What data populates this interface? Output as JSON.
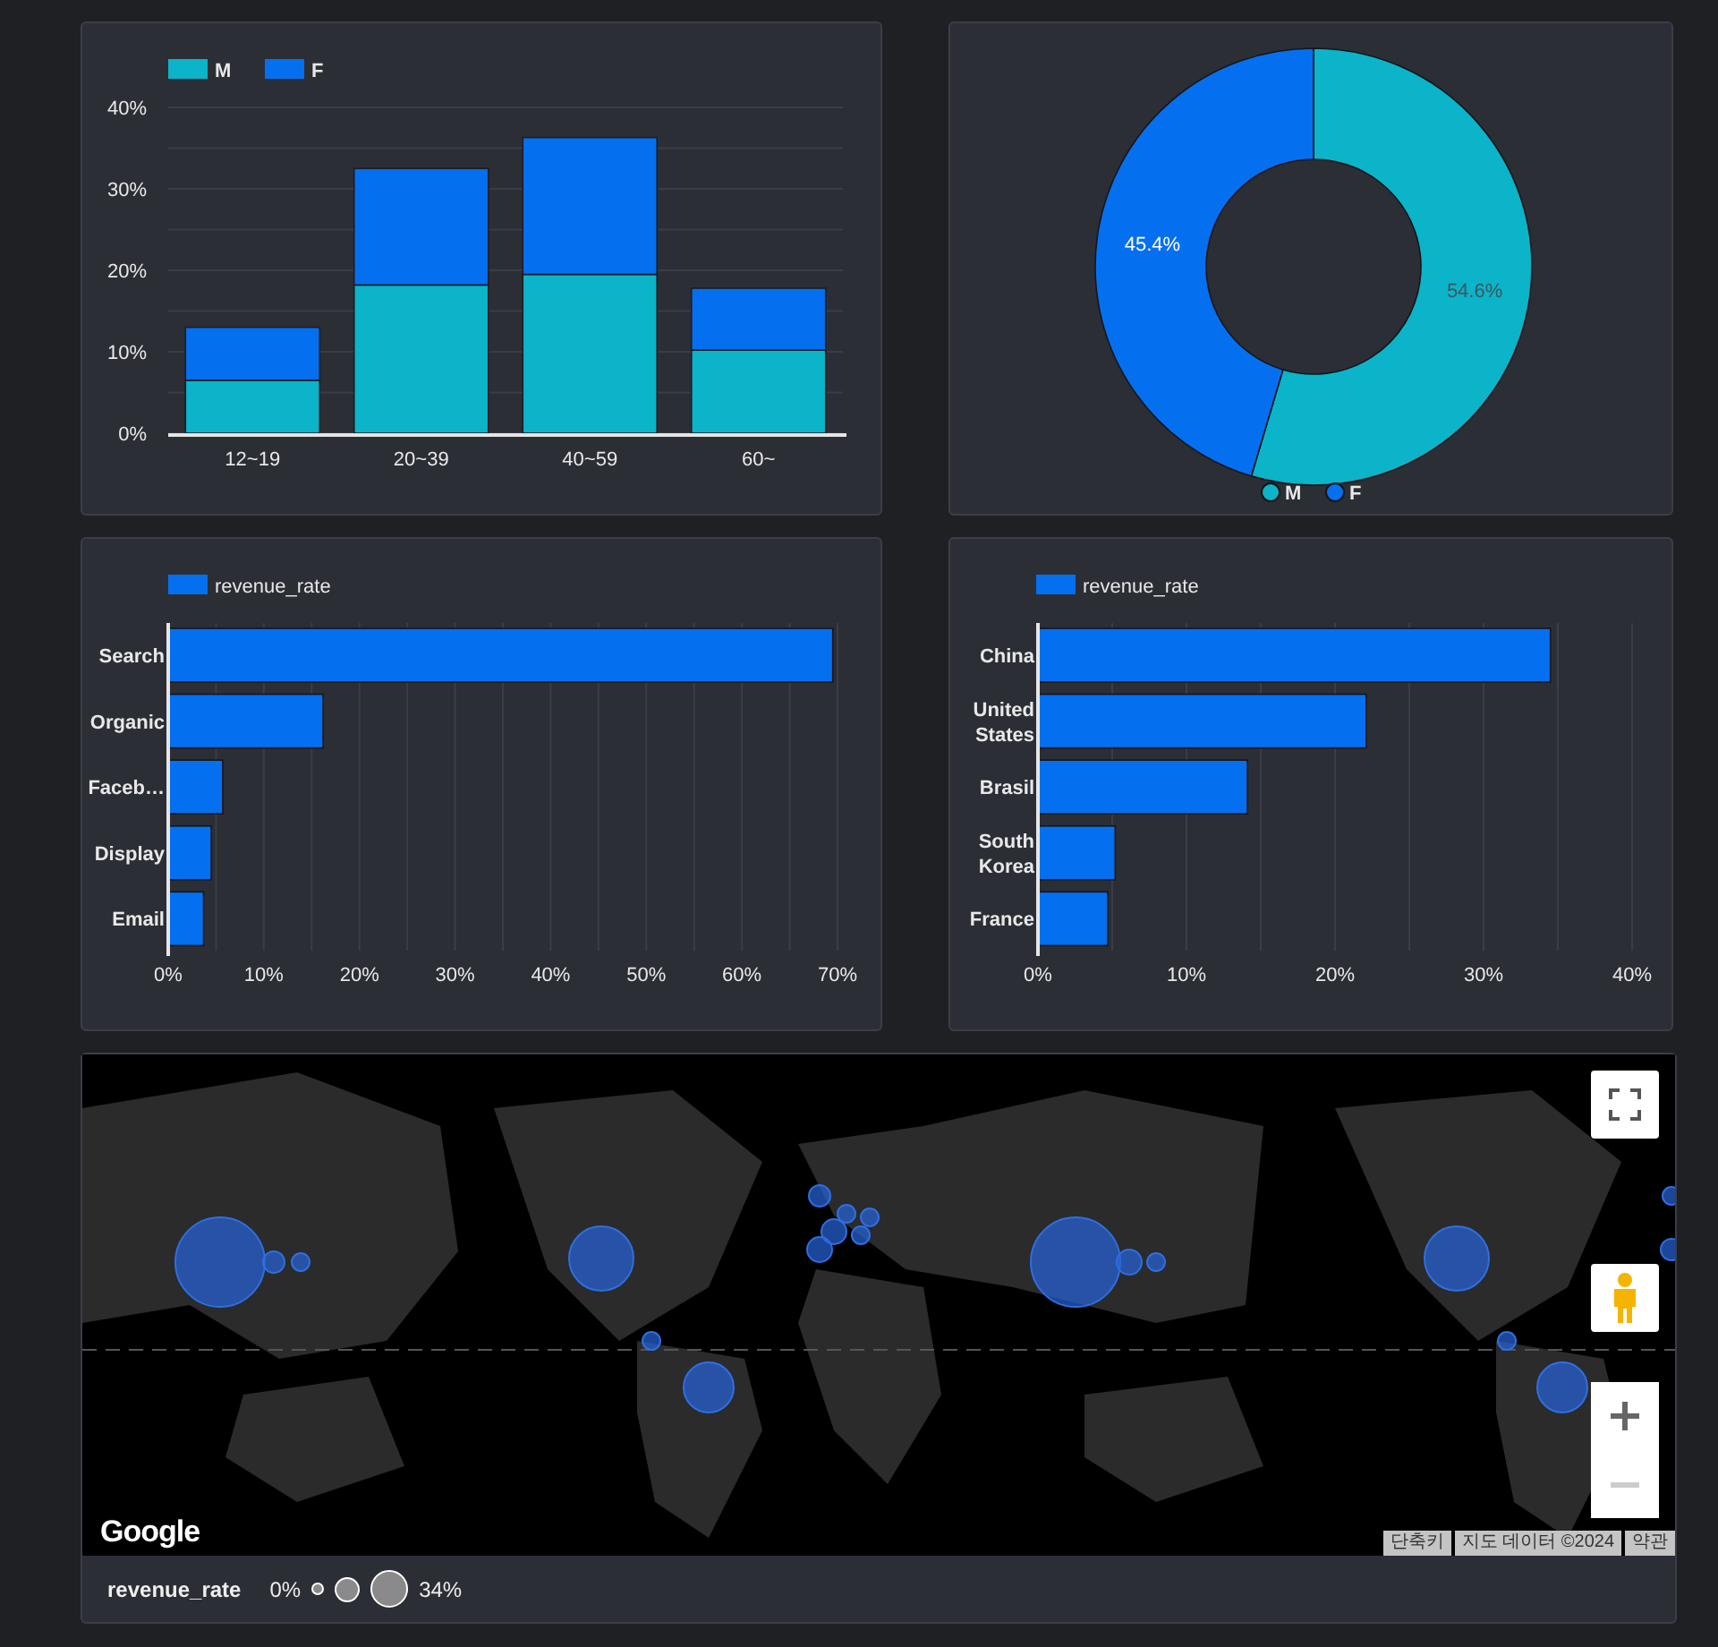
{
  "age_gender_chart": {
    "chart_data": {
      "type": "bar",
      "stacked": true,
      "categories": [
        "12~19",
        "20~39",
        "40~59",
        "60~"
      ],
      "series": [
        {
          "name": "M",
          "color": "#0bb4c8",
          "values": [
            6.5,
            18.2,
            19.5,
            10.2
          ]
        },
        {
          "name": "F",
          "color": "#0570ef",
          "values": [
            6.5,
            14.3,
            16.8,
            7.6
          ]
        }
      ],
      "grid": true,
      "legend": true,
      "ylim": [
        0,
        40
      ],
      "yticks": [
        {
          "value": 0,
          "label": "0%"
        },
        {
          "value": 10,
          "label": "10%"
        },
        {
          "value": 20,
          "label": "20%"
        },
        {
          "value": 30,
          "label": "30%"
        },
        {
          "value": 40,
          "label": "40%"
        }
      ]
    }
  },
  "gender_chart": {
    "chart_data": {
      "type": "donut",
      "categories": [
        "M",
        "F"
      ],
      "values": [
        54.6,
        45.4
      ],
      "data_labels": true,
      "value_labels": [
        "54.6%",
        "45.4%"
      ],
      "legend": true
    }
  },
  "channel_chart": {
    "chart_data": {
      "type": "bar",
      "orientation": "horizontal",
      "categories": [
        "Search",
        "Organic",
        "Faceb…",
        "Display",
        "Email"
      ],
      "series": [
        {
          "name": "revenue_rate",
          "color": "#0570ef",
          "values": [
            69.5,
            16.2,
            5.7,
            4.5,
            3.7
          ]
        }
      ],
      "grid": true,
      "legend": true,
      "xlim": [
        0,
        70
      ],
      "xticks": [
        {
          "value": 0,
          "label": "0%"
        },
        {
          "value": 10,
          "label": "10%"
        },
        {
          "value": 20,
          "label": "20%"
        },
        {
          "value": 30,
          "label": "30%"
        },
        {
          "value": 40,
          "label": "40%"
        },
        {
          "value": 50,
          "label": "50%"
        },
        {
          "value": 60,
          "label": "60%"
        },
        {
          "value": 70,
          "label": "70%"
        }
      ]
    }
  },
  "country_chart": {
    "chart_data": {
      "type": "bar",
      "orientation": "horizontal",
      "categories": [
        "China",
        "United States",
        "Brasil",
        "South Korea",
        "France"
      ],
      "series": [
        {
          "name": "revenue_rate",
          "color": "#0570ef",
          "values": [
            34.5,
            22.1,
            14.1,
            5.2,
            4.7
          ]
        }
      ],
      "grid": true,
      "legend": true,
      "xlim": [
        0,
        40
      ],
      "xticks": [
        {
          "value": 0,
          "label": "0%"
        },
        {
          "value": 10,
          "label": "10%"
        },
        {
          "value": 20,
          "label": "20%"
        },
        {
          "value": 30,
          "label": "30%"
        },
        {
          "value": 40,
          "label": "40%"
        }
      ]
    }
  },
  "map": {
    "kind": "picture",
    "logo": "Google",
    "attribution": [
      "단축키",
      "지도 데이터 ©2024",
      "약관"
    ],
    "legend": {
      "title": "revenue_rate",
      "min": "0%",
      "max": "34%"
    }
  }
}
